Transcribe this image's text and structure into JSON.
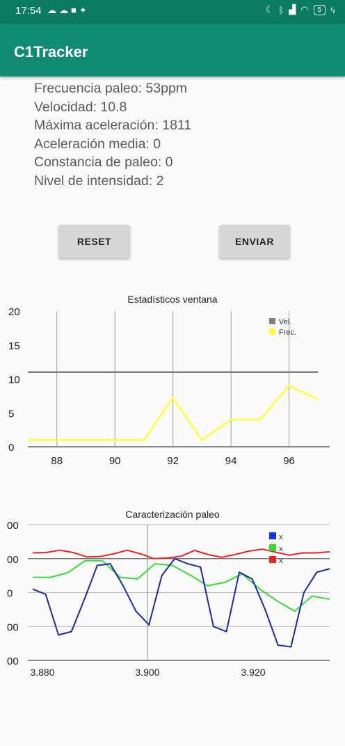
{
  "status_bar": {
    "time": "17:54",
    "notification_icons": [
      "cloud-icon",
      "cloud-icon",
      "video-icon",
      "twitter-icon"
    ],
    "right_icons": [
      "moon-icon",
      "bluetooth-icon",
      "signal-icon",
      "wifi-icon",
      "battery-icon"
    ],
    "battery_level": "5"
  },
  "app_bar": {
    "title": "C1Tracker"
  },
  "stats": [
    "Frecuencia paleo: 53ppm",
    "Velocidad: 10.8",
    "Máxima aceleración: 1811",
    "Aceleración media: 0",
    "Constancia de paleo: 0",
    "Nivel de intensidad: 2"
  ],
  "buttons": {
    "reset_label": "RESET",
    "send_label": "ENVIAR"
  },
  "colors": {
    "app_bar": "#0f8c73",
    "status_bar": "#0a7a61"
  },
  "chart_data": [
    {
      "type": "line",
      "title": "Estadísticos ventana",
      "x": [
        87,
        88,
        89,
        90,
        91,
        92,
        93,
        94,
        95,
        96,
        97
      ],
      "x_ticks": [
        "88",
        "90",
        "92",
        "94",
        "96"
      ],
      "y_ticks": [
        "0",
        "5",
        "10",
        "15",
        "20"
      ],
      "ylim": [
        0,
        20
      ],
      "series": [
        {
          "name": "Vel.",
          "color": "#808080",
          "values": [
            11,
            11,
            11,
            11,
            11,
            11,
            11,
            11,
            11,
            11,
            11
          ]
        },
        {
          "name": "Frec.",
          "color": "#ffff33",
          "values": [
            1,
            1,
            1,
            1,
            1,
            7.2,
            1,
            4,
            4,
            9,
            7
          ]
        }
      ],
      "legend": "top-right",
      "grid": true
    },
    {
      "type": "line",
      "title": "Caracterización paleo",
      "x_ticks": [
        "3.880",
        "3.900",
        "3.920"
      ],
      "y_ticks": [
        "00",
        "00",
        "0",
        "00",
        "00"
      ],
      "legend_labels": [
        "x",
        "x",
        "x"
      ],
      "legend": "top-right",
      "grid": true,
      "series": [
        {
          "color": "#ee2222",
          "y": [
            0.17,
            0.18,
            0.25,
            0.18,
            0.05,
            0.06,
            0.14,
            0.25,
            0.14,
            0.0,
            0.02,
            0.07,
            0.24,
            0.12,
            0.04,
            0.12,
            0.22,
            0.28,
            0.19,
            0.1,
            0.17,
            0.17,
            0.2
          ]
        },
        {
          "color": "#33dd33",
          "y": [
            -0.55,
            -0.55,
            -0.42,
            -0.06,
            -0.06,
            -0.55,
            -0.6,
            -0.15,
            -0.2,
            -0.48,
            -0.8,
            -0.7,
            -0.45,
            -0.9,
            -1.25,
            -1.55,
            -1.1,
            -1.2
          ]
        },
        {
          "color": "#1a2aa0",
          "y": [
            -0.9,
            -1.05,
            -2.25,
            -2.15,
            -1.2,
            -0.2,
            -0.15,
            -0.8,
            -1.55,
            -1.95,
            -0.5,
            0.0,
            -0.15,
            -0.25,
            -2.0,
            -2.15,
            -0.4,
            -0.6,
            -1.5,
            -2.55,
            -2.6,
            -1.0,
            -0.4,
            -0.3
          ]
        }
      ]
    }
  ]
}
